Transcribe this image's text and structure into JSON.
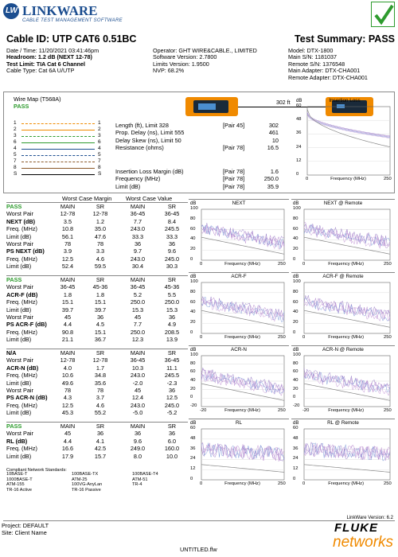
{
  "brand": {
    "name": "LINKWARE",
    "tagline": "CABLE TEST MANAGEMENT SOFTWARE",
    "logo_letters": "LW"
  },
  "title": {
    "cable_id": "Cable ID: UTP CAT6 0.51BC",
    "summary": "Test Summary: PASS"
  },
  "info_left": [
    "Date / Time: 11/20/2021 03:41:46pm",
    "Headroom: 1.2 dB (NEXT 12-78)",
    "Test Limit: TIA Cat 6 Channel",
    "Cable Type: Cat 6A U/UTP"
  ],
  "info_mid": [
    "Operator: GHT WIRE&CABLE., LIMITED",
    "Software Version: 2.7800",
    "Limits Version: 1.9500",
    "NVP: 68.2%"
  ],
  "info_right": [
    "Model: DTX-1800",
    "Main S/N: 1181037",
    "Remote S/N: 1376548",
    "Main Adapter: DTX-CHA001",
    "Remote Adapter: DTX-CHA001"
  ],
  "wiremap": {
    "title": "Wire Map (T568A)",
    "result": "PASS",
    "pins": [
      "1",
      "2",
      "3",
      "6",
      "4",
      "5",
      "7",
      "8",
      "S"
    ],
    "length_label": "302 ft"
  },
  "measure": [
    {
      "label": "Length (ft), Limit 328",
      "pair": "[Pair 45]",
      "value": "302"
    },
    {
      "label": "Prop. Delay (ns), Limit 555",
      "pair": "",
      "value": "461"
    },
    {
      "label": "Delay Skew (ns), Limit 50",
      "pair": "",
      "value": "10"
    },
    {
      "label": "Resistance (ohms)",
      "pair": "[Pair 78]",
      "value": "16.5"
    }
  ],
  "ilmargin": [
    {
      "label": "Insertion Loss Margin (dB)",
      "pair": "[Pair 78]",
      "value": "1.6"
    },
    {
      "label": "Frequency (MHz)",
      "pair": "[Pair 78]",
      "value": "250.0"
    },
    {
      "label": "Limit (dB)",
      "pair": "[Pair 78]",
      "value": "35.9"
    }
  ],
  "col_groups": {
    "worst_margin": "Worst Case Margin",
    "worst_value": "Worst Case Value"
  },
  "sections": [
    {
      "rows": [
        [
          "PASS",
          "MAIN",
          "SR",
          "MAIN",
          "SR"
        ],
        [
          "Worst Pair",
          "12-78",
          "12-78",
          "36-45",
          "36-45"
        ],
        [
          "NEXT (dB)",
          "3.5",
          "1.2",
          "7.7",
          "8.4"
        ],
        [
          "Freq. (MHz)",
          "10.8",
          "35.0",
          "243.0",
          "245.5"
        ],
        [
          "Limit (dB)",
          "56.1",
          "47.6",
          "33.3",
          "33.3"
        ],
        [
          "Worst Pair",
          "78",
          "78",
          "36",
          "36"
        ],
        [
          "PS NEXT (dB)",
          "3.9",
          "3.3",
          "9.7",
          "9.6"
        ],
        [
          "Freq. (MHz)",
          "12.5",
          "4.6",
          "243.0",
          "245.0"
        ],
        [
          "Limit (dB)",
          "52.4",
          "59.5",
          "30.4",
          "30.3"
        ]
      ]
    },
    {
      "rows": [
        [
          "PASS",
          "MAIN",
          "SR",
          "MAIN",
          "SR"
        ],
        [
          "Worst Pair",
          "36-45",
          "45-36",
          "36-45",
          "45-36"
        ],
        [
          "ACR-F (dB)",
          "1.8",
          "1.8",
          "5.2",
          "5.5"
        ],
        [
          "Freq. (MHz)",
          "15.1",
          "15.1",
          "250.0",
          "250.0"
        ],
        [
          "Limit (dB)",
          "39.7",
          "39.7",
          "15.3",
          "15.3"
        ],
        [
          "Worst Pair",
          "45",
          "36",
          "45",
          "36"
        ],
        [
          "PS ACR-F (dB)",
          "4.4",
          "4.5",
          "7.7",
          "4.9"
        ],
        [
          "Freq. (MHz)",
          "90.8",
          "15.1",
          "250.0",
          "208.5"
        ],
        [
          "Limit (dB)",
          "21.1",
          "36.7",
          "12.3",
          "13.9"
        ]
      ]
    },
    {
      "rows": [
        [
          "N/A",
          "MAIN",
          "SR",
          "MAIN",
          "SR"
        ],
        [
          "Worst Pair",
          "12-78",
          "12-78",
          "36-45",
          "36-45"
        ],
        [
          "ACR-N (dB)",
          "4.0",
          "1.7",
          "10.3",
          "11.1"
        ],
        [
          "Freq. (MHz)",
          "10.6",
          "34.8",
          "243.0",
          "245.5"
        ],
        [
          "Limit (dB)",
          "49.6",
          "35.6",
          "-2.0",
          "-2.3"
        ],
        [
          "Worst Pair",
          "78",
          "78",
          "45",
          "36"
        ],
        [
          "PS ACR-N (dB)",
          "4.3",
          "3.7",
          "12.4",
          "12.5"
        ],
        [
          "Freq. (MHz)",
          "12.5",
          "4.6",
          "243.0",
          "245.0"
        ],
        [
          "Limit (dB)",
          "45.3",
          "55.2",
          "-5.0",
          "-5.2"
        ]
      ]
    },
    {
      "rows": [
        [
          "PASS",
          "MAIN",
          "SR",
          "MAIN",
          "SR"
        ],
        [
          "Worst Pair",
          "45",
          "36",
          "36",
          "36"
        ],
        [
          "RL (dB)",
          "4.4",
          "4.1",
          "9.6",
          "6.0"
        ],
        [
          "Freq. (MHz)",
          "16.6",
          "42.5",
          "249.0",
          "160.0"
        ],
        [
          "Limit (dB)",
          "17.9",
          "15.7",
          "8.0",
          "10.0"
        ]
      ]
    }
  ],
  "standards": {
    "title": "Compliant Network Standards:",
    "items": [
      "10BASE-T",
      "100BASE-TX",
      "100BASE-T4",
      "1000BASE-T",
      "ATM-25",
      "ATM-51",
      "ATM-155",
      "100VG-AnyLan",
      "TR-4",
      "TR-16 Active",
      "TR-16 Passive"
    ]
  },
  "charts": [
    {
      "title": "Insertion Loss",
      "unit": "dB",
      "xlabel": "Frequency (MHz)",
      "xmax": "250",
      "ticks": [
        "60",
        "48",
        "36",
        "24",
        "12",
        "0"
      ]
    },
    {
      "title": "NEXT",
      "unit": "dB",
      "xlabel": "Frequency (MHz)",
      "xmax": "250",
      "ticks": [
        "100",
        "80",
        "60",
        "40",
        "20",
        "0"
      ]
    },
    {
      "title": "NEXT @ Remote",
      "unit": "dB",
      "xlabel": "Frequency (MHz)",
      "xmax": "250",
      "ticks": [
        "100",
        "80",
        "60",
        "40",
        "20",
        "0"
      ]
    },
    {
      "title": "ACR-F",
      "unit": "dB",
      "xlabel": "Frequency (MHz)",
      "xmax": "250",
      "ticks": [
        "100",
        "80",
        "60",
        "40",
        "20",
        "0"
      ]
    },
    {
      "title": "ACR-F @ Remote",
      "unit": "dB",
      "xlabel": "Frequency (MHz)",
      "xmax": "250",
      "ticks": [
        "100",
        "80",
        "60",
        "40",
        "20",
        "0"
      ]
    },
    {
      "title": "ACR-N",
      "unit": "dB",
      "xlabel": "Frequency (MHz)",
      "xmax": "250",
      "ticks": [
        "100",
        "80",
        "60",
        "40",
        "20",
        "0",
        "-20"
      ]
    },
    {
      "title": "ACR-N @ Remote",
      "unit": "dB",
      "xlabel": "Frequency (MHz)",
      "xmax": "250",
      "ticks": [
        "100",
        "80",
        "60",
        "40",
        "20",
        "0",
        "-20"
      ]
    },
    {
      "title": "RL",
      "unit": "dB",
      "xlabel": "Frequency (MHz)",
      "xmax": "250",
      "ticks": [
        "60",
        "48",
        "36",
        "24",
        "12",
        "0"
      ]
    },
    {
      "title": "RL @ Remote",
      "unit": "dB",
      "xlabel": "Frequency (MHz)",
      "xmax": "250",
      "ticks": [
        "60",
        "48",
        "36",
        "24",
        "12",
        "0"
      ]
    }
  ],
  "footer": {
    "version": "LinkWare Version: 6.2",
    "project": "Project: DEFAULT",
    "site": "Site: Client Name",
    "file": "UNTITLED.flw",
    "fluke": "FLUKE",
    "networks": "networks"
  },
  "colors": {
    "brand_blue": "#1b4d8f",
    "pass_green": "#2e9b2e",
    "device_orange": "#f08a00"
  }
}
